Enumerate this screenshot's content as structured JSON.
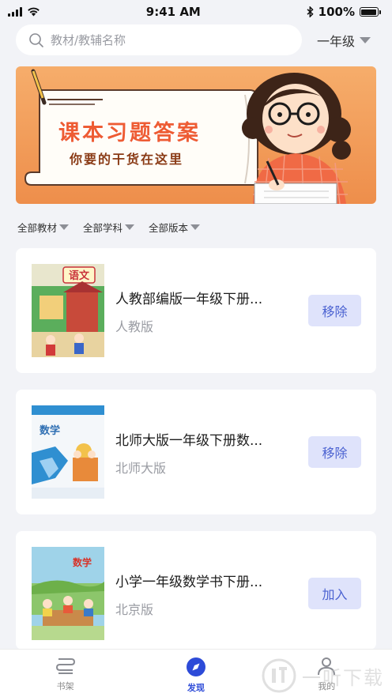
{
  "status_bar": {
    "time": "9:41 AM",
    "battery": "100%"
  },
  "search": {
    "placeholder": "教材/教辅名称"
  },
  "grade_select": {
    "value": "一年级"
  },
  "banner": {
    "headline": "课本习题答案",
    "subtitle": "你要的干货在这里"
  },
  "filters": [
    "全部教材",
    "全部学科",
    "全部版本"
  ],
  "books": [
    {
      "title": "人教部编版一年级下册...",
      "publisher": "人教版",
      "action": "移除",
      "cover_text": "语文"
    },
    {
      "title": "北师大版一年级下册数...",
      "publisher": "北师大版",
      "action": "移除",
      "cover_text": "数学"
    },
    {
      "title": "小学一年级数学书下册...",
      "publisher": "北京版",
      "action": "加入",
      "cover_text": "数学"
    }
  ],
  "tabs": [
    {
      "label": "书架",
      "icon": "bookshelf-icon",
      "active": false
    },
    {
      "label": "发现",
      "icon": "compass-icon",
      "active": true
    },
    {
      "label": "我的",
      "icon": "person-icon",
      "active": false
    }
  ],
  "watermark": {
    "text": "一听下载"
  },
  "colors": {
    "accent": "#2d4bd8",
    "button_bg": "#dfe3fb",
    "button_text": "#4b62d1",
    "banner": "#f09a55"
  }
}
